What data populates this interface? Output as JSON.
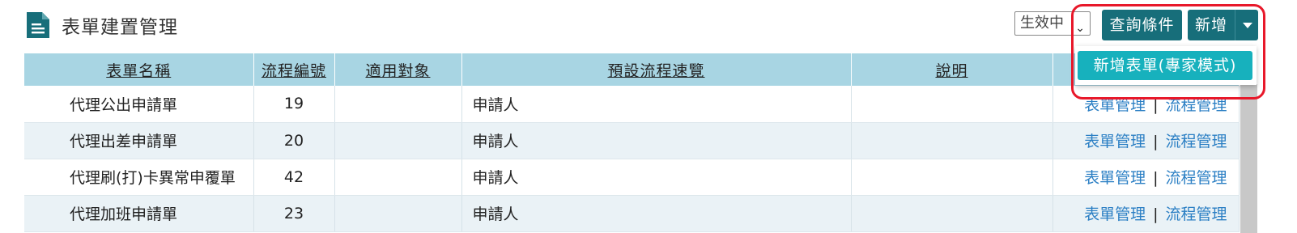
{
  "header": {
    "title": "表單建置管理",
    "title_icon": "document-icon",
    "status_filter": {
      "selected": "生效中"
    },
    "query_button": "查詢條件",
    "add_button": "新增"
  },
  "add_menu": {
    "items": [
      {
        "label": "新增表單(專家模式)"
      }
    ]
  },
  "table": {
    "columns": [
      "表單名稱",
      "流程編號",
      "適用對象",
      "預設流程速覽",
      "說明",
      ""
    ],
    "rows": [
      {
        "name": "代理公出申請單",
        "flow_no": "19",
        "target": "",
        "preview": "申請人",
        "desc": "",
        "actions": [
          "表單管理",
          "流程管理"
        ]
      },
      {
        "name": "代理出差申請單",
        "flow_no": "20",
        "target": "",
        "preview": "申請人",
        "desc": "",
        "actions": [
          "表單管理",
          "流程管理"
        ]
      },
      {
        "name": "代理刷(打)卡異常申覆單",
        "flow_no": "42",
        "target": "",
        "preview": "申請人",
        "desc": "",
        "actions": [
          "表單管理",
          "流程管理"
        ]
      },
      {
        "name": "代理加班申請單",
        "flow_no": "23",
        "target": "",
        "preview": "申請人",
        "desc": "",
        "actions": [
          "表單管理",
          "流程管理"
        ]
      }
    ]
  },
  "colors": {
    "primary_button": "#176e7a",
    "menu_item": "#17b1bd",
    "table_header": "#a8d5e3",
    "link": "#2b7fc4",
    "highlight": "#e8182a"
  }
}
